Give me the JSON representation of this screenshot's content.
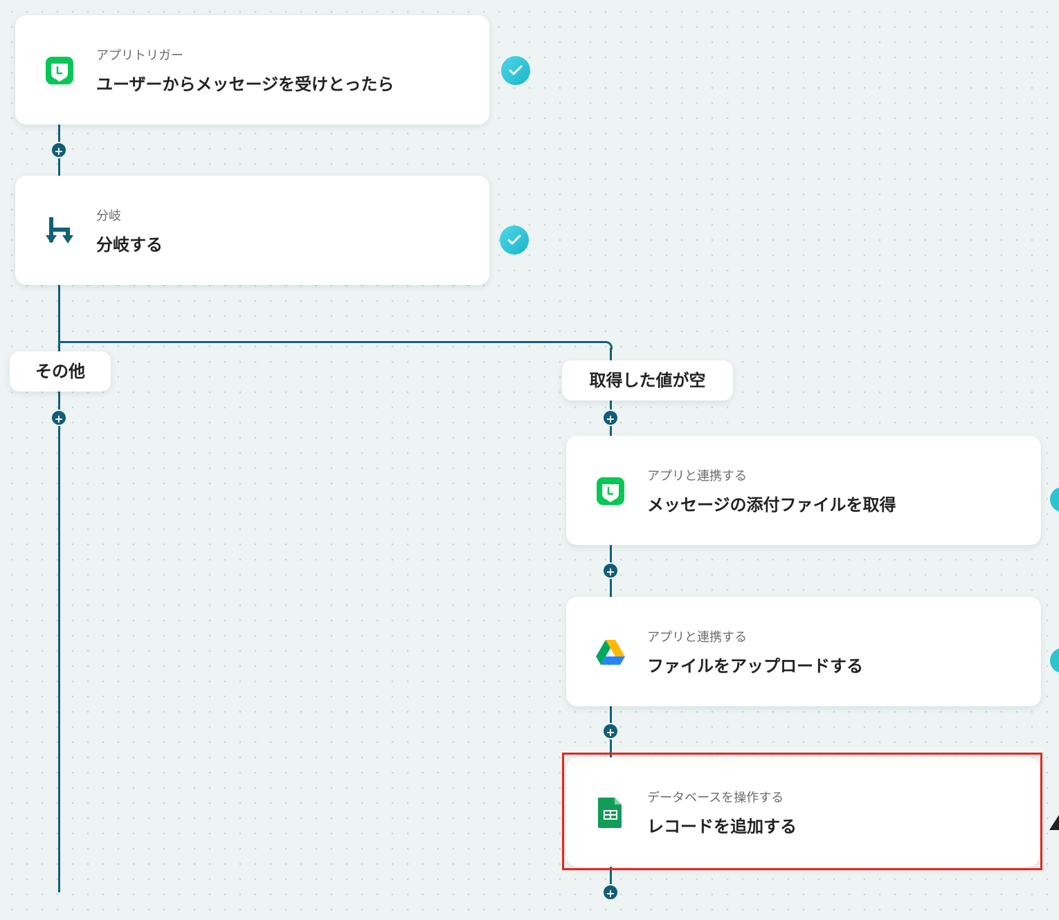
{
  "steps": [
    {
      "subtitle": "アプリトリガー",
      "title": "ユーザーからメッセージを受けとったら",
      "icon": "line-app-icon",
      "status": "completed"
    },
    {
      "subtitle": "分岐",
      "title": "分岐する",
      "icon": "branch-icon",
      "status": "completed"
    },
    {
      "subtitle": "アプリと連携する",
      "title": "メッセージの添付ファイルを取得",
      "icon": "line-app-icon"
    },
    {
      "subtitle": "アプリと連携する",
      "title": "ファイルをアップロードする",
      "icon": "google-drive-icon"
    },
    {
      "subtitle": "データベースを操作する",
      "title": "レコードを追加する",
      "icon": "google-sheets-icon",
      "highlighted": true
    }
  ],
  "branches": {
    "left": {
      "label": "その他"
    },
    "right": {
      "label": "取得した値が空"
    }
  },
  "add_step_symbol": "+",
  "colors": {
    "line": "#12607a",
    "check": "#1ab5c8",
    "highlight": "#e8251c",
    "line_app": "#06c755"
  }
}
